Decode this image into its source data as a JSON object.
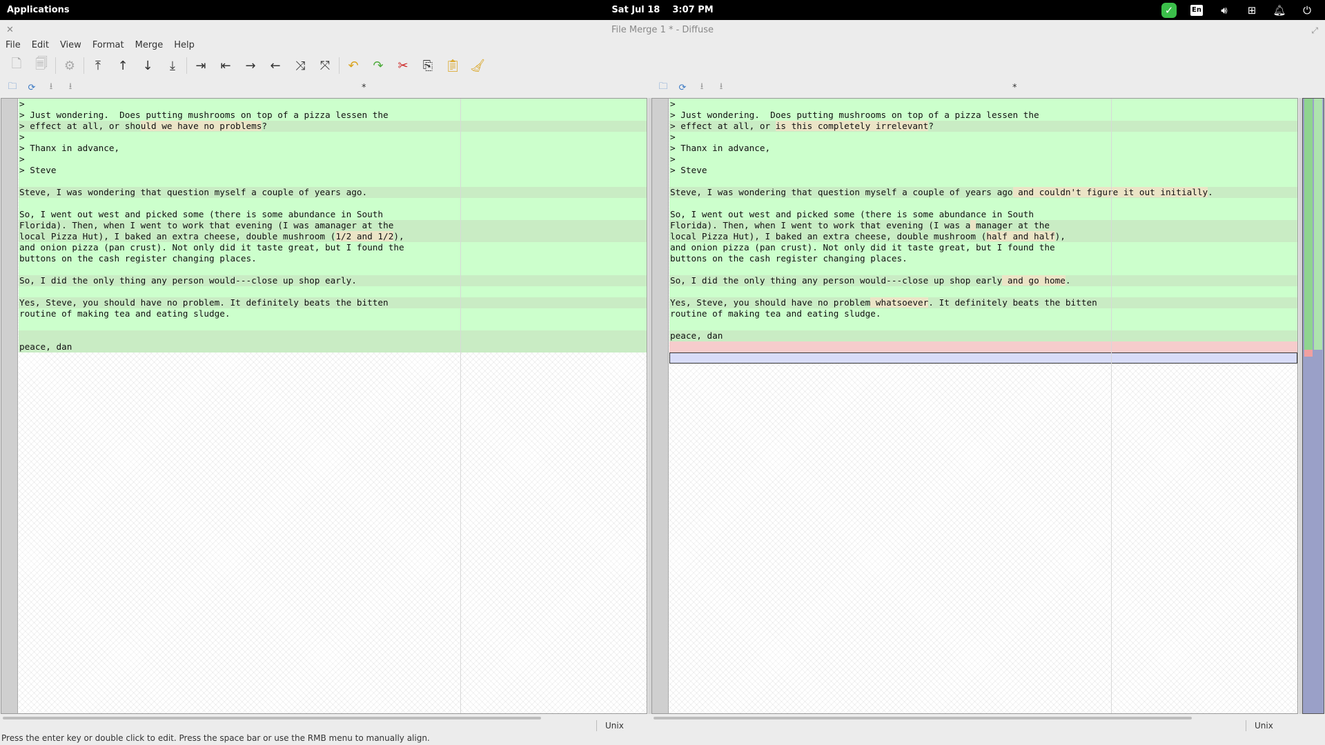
{
  "topbar": {
    "applications": "Applications",
    "date": "Sat Jul 18",
    "time": "3:07 PM",
    "lang": "En"
  },
  "window": {
    "title": "File Merge 1 * - Diffuse"
  },
  "menu": [
    "File",
    "Edit",
    "View",
    "Format",
    "Merge",
    "Help"
  ],
  "panes": {
    "left_title": "*",
    "right_title": "*",
    "left_encoding": "Unix",
    "right_encoding": "Unix",
    "left_lines": [
      {
        "t": ">",
        "k": "ch"
      },
      {
        "t": "> Just wondering.  Does putting mushrooms on top of a pizza lessen the",
        "k": "ch"
      },
      {
        "t": "> effect at all, or sho",
        "h": "uld we have no problems",
        "a": "?",
        "k": "mod"
      },
      {
        "t": ">",
        "k": "ch"
      },
      {
        "t": "> Thanx in advance,",
        "k": "ch"
      },
      {
        "t": ">",
        "k": "ch"
      },
      {
        "t": "> Steve",
        "k": "ch"
      },
      {
        "t": "",
        "k": "ch"
      },
      {
        "t": "Steve, I was wondering that question myself a couple of years ago.",
        "k": "mod"
      },
      {
        "t": "",
        "k": "ch"
      },
      {
        "t": "So, I went out west and picked some (there is some abundance in South",
        "k": "ch"
      },
      {
        "t": "Florida). Then, when I went to work that evening (I was ama",
        "h": "",
        "a": "nager at the",
        "k": "mod"
      },
      {
        "t": "local Pizza Hut), I baked an extra cheese, double mushroom (",
        "h": "1/2 and 1/2",
        "a": "),",
        "k": "mod"
      },
      {
        "t": "and onion pizza (pan crust). Not only did it taste great, but I found the",
        "k": "ch"
      },
      {
        "t": "buttons on the cash register changing places.",
        "k": "ch"
      },
      {
        "t": "",
        "k": "ch"
      },
      {
        "t": "So, I did the only thing any person would---close up shop early.",
        "k": "mod"
      },
      {
        "t": "",
        "k": "ch"
      },
      {
        "t": "Yes, Steve, you should have no problem. It definitely beats the bitten",
        "k": "mod"
      },
      {
        "t": "routine of making tea and eating sludge.",
        "k": "ch"
      },
      {
        "t": "",
        "k": "ch"
      },
      {
        "t": "",
        "k": "mod"
      },
      {
        "t": "peace, dan",
        "k": "mod"
      }
    ],
    "right_lines": [
      {
        "t": ">",
        "k": "ch"
      },
      {
        "t": "> Just wondering.  Does putting mushrooms on top of a pizza lessen the",
        "k": "ch"
      },
      {
        "t": "> effect at all, or ",
        "h": "is this completely irrelevant",
        "a": "?",
        "k": "mod"
      },
      {
        "t": ">",
        "k": "ch"
      },
      {
        "t": "> Thanx in advance,",
        "k": "ch"
      },
      {
        "t": ">",
        "k": "ch"
      },
      {
        "t": "> Steve",
        "k": "ch"
      },
      {
        "t": "",
        "k": "ch"
      },
      {
        "t": "Steve, I was wondering that question myself a couple of years ago",
        "h": " and couldn't figure it out initially",
        "a": ".",
        "k": "mod"
      },
      {
        "t": "",
        "k": "ch"
      },
      {
        "t": "So, I went out west and picked some (there is some abundance in South",
        "k": "ch"
      },
      {
        "t": "Florida). Then, when I went to work that evening (I was a",
        "h": " ",
        "a": "manager at the",
        "k": "mod"
      },
      {
        "t": "local Pizza Hut), I baked an extra cheese, double mushroom (",
        "h": "half and half",
        "a": "),",
        "k": "mod"
      },
      {
        "t": "and onion pizza (pan crust). Not only did it taste great, but I found the",
        "k": "ch"
      },
      {
        "t": "buttons on the cash register changing places.",
        "k": "ch"
      },
      {
        "t": "",
        "k": "ch"
      },
      {
        "t": "So, I did the only thing any person would---close up shop early",
        "h": " and go home",
        "a": ".",
        "k": "mod"
      },
      {
        "t": "",
        "k": "ch"
      },
      {
        "t": "Yes, Steve, you should have no problem",
        "h": " whatsoever",
        "a": ". It definitely beats the bitten",
        "k": "mod"
      },
      {
        "t": "routine of making tea and eating sludge.",
        "k": "ch"
      },
      {
        "t": "",
        "k": "ch"
      },
      {
        "t": "peace, dan",
        "k": "mod"
      },
      {
        "t": "",
        "k": "del"
      },
      {
        "t": "",
        "k": "sel"
      }
    ]
  },
  "status": "Press the enter key or double click to edit.  Press the space bar or use the RMB menu to manually align."
}
